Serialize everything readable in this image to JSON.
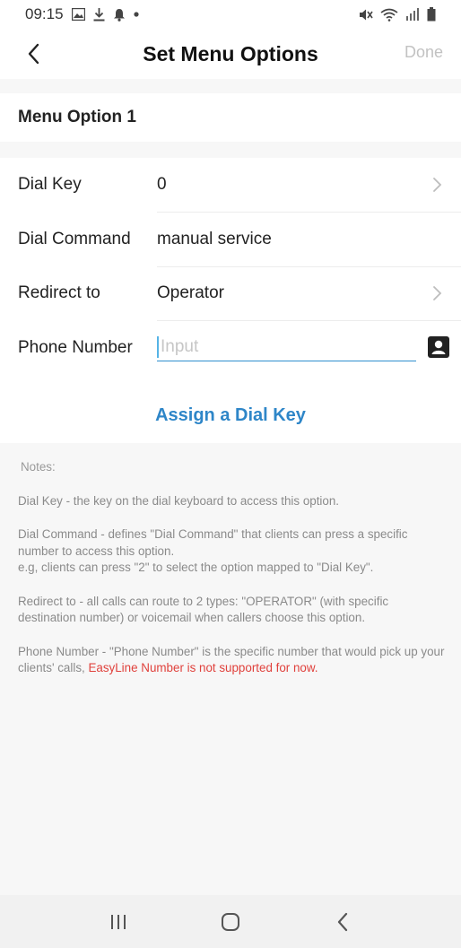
{
  "status_bar": {
    "time": "09:15",
    "left_icons": [
      "image-icon",
      "download-icon",
      "notification-bell-icon",
      "dot-icon"
    ],
    "right_icons": [
      "mute-icon",
      "wifi-icon",
      "signal-icon",
      "battery-icon"
    ]
  },
  "header": {
    "title": "Set Menu Options",
    "done_label": "Done",
    "back_icon": "chevron-left-icon"
  },
  "section": {
    "title": "Menu Option 1"
  },
  "form": {
    "rows": [
      {
        "label": "Dial Key",
        "value": "0",
        "has_chevron": true
      },
      {
        "label": "Dial Command",
        "value": "manual service",
        "has_chevron": false
      },
      {
        "label": "Redirect to",
        "value": "Operator",
        "has_chevron": true
      },
      {
        "label": "Phone Number",
        "value": "",
        "has_chevron": false
      }
    ],
    "phone_placeholder": "Input",
    "contact_icon": "contact-book-icon"
  },
  "assign": {
    "label": "Assign a Dial Key"
  },
  "notes": {
    "title": "Notes:",
    "dial_key": "Dial Key - the key on the dial keyboard to access this option.",
    "dial_command_1": "Dial Command - defines \"Dial Command\" that clients can press a specific number to access this option.",
    "dial_command_2": "e.g, clients can press \"2\" to select the option mapped to \"Dial Key\".",
    "redirect": "Redirect to - all calls can route to 2 types: \"OPERATOR\" (with specific destination number) or voicemail when callers choose this option.",
    "phone_number": "Phone Number - \"Phone Number\" is the specific number that would pick up your clients' calls, ",
    "phone_number_warning": "EasyLine Number is not supported for now."
  },
  "nav_bar": {
    "icons": [
      "recent-apps-icon",
      "home-icon",
      "back-icon"
    ]
  },
  "colors": {
    "accent": "#2e86c8",
    "warning": "#e0413c",
    "done_disabled": "#c2c2c2",
    "background": "#f7f7f7"
  }
}
